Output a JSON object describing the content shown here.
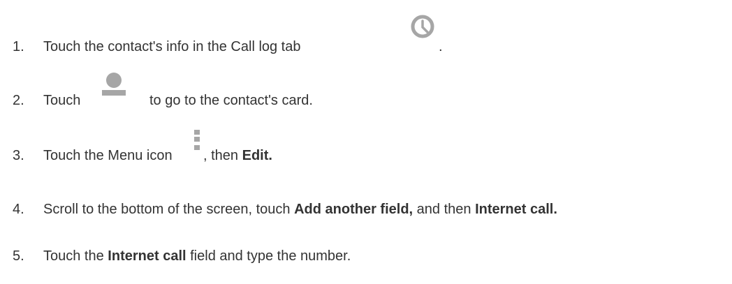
{
  "steps": [
    {
      "number": "1.",
      "text_before": "Touch the contact's info in the Call log tab",
      "icon": "clock-icon",
      "text_after": "."
    },
    {
      "number": "2.",
      "text_before": "Touch",
      "icon": "contact-person-icon",
      "text_after": "to go to the contact's card."
    },
    {
      "number": "3.",
      "text_before": "Touch the Menu icon",
      "icon": "menu-icon",
      "text_middle": ", then",
      "bold": "Edit."
    },
    {
      "number": "4.",
      "text_before": "Scroll to the bottom of the screen, touch",
      "bold_1": "Add another field,",
      "text_middle": "and then",
      "bold_2": "Internet call."
    },
    {
      "number": "5.",
      "text_before": "Touch the",
      "bold": "Internet call",
      "text_after": "field and type the number."
    }
  ],
  "colors": {
    "text": "#333333",
    "icon": "#a6a6a6"
  }
}
